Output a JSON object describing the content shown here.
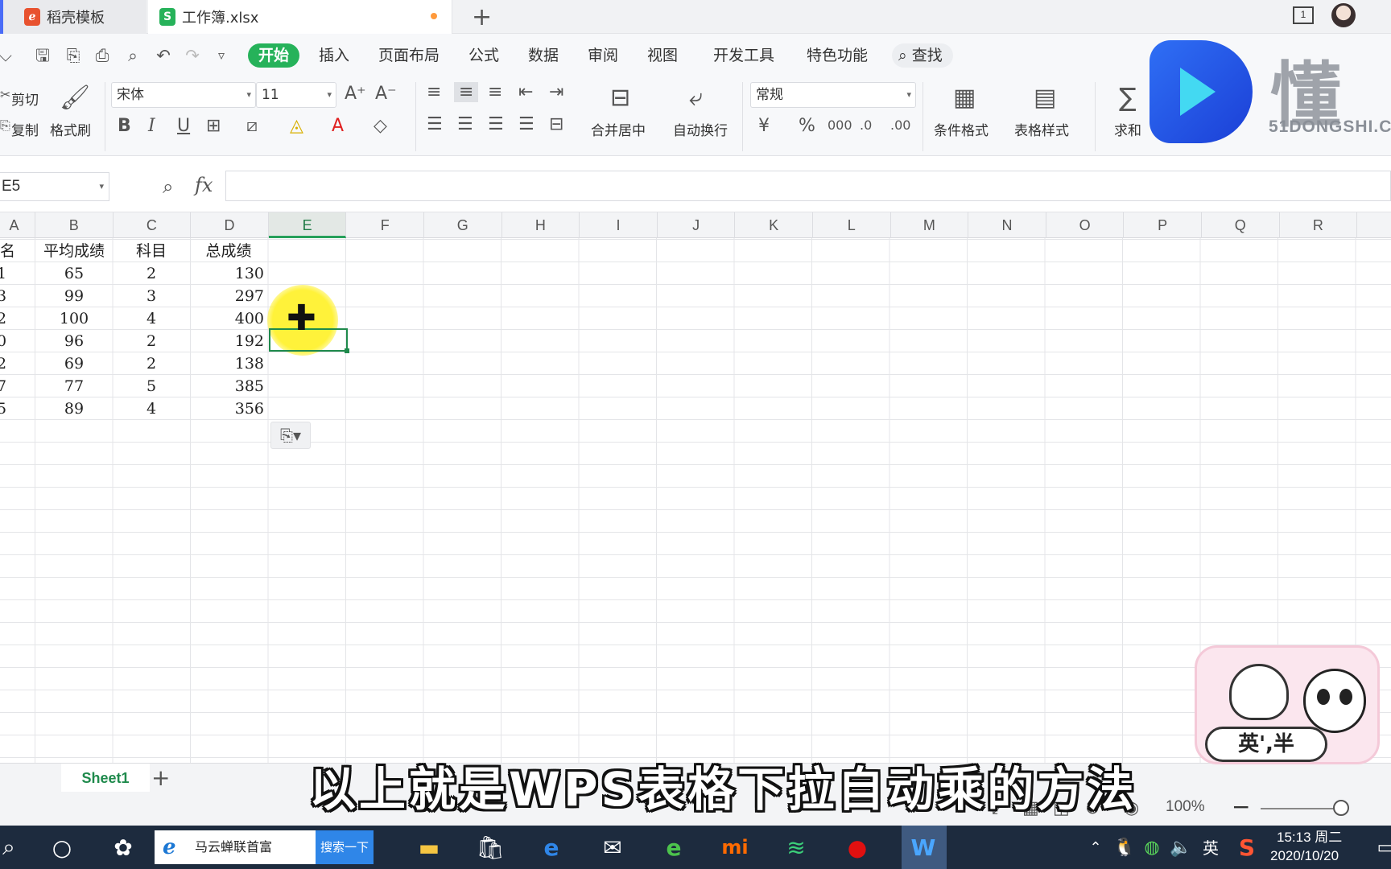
{
  "tabs": [
    {
      "label": "稻壳模板",
      "icon": "docer-icon",
      "color": "#e8522f"
    },
    {
      "label": "工作簿.xlsx",
      "icon": "spreadsheet-icon",
      "color": "#26b25a"
    }
  ],
  "menu": {
    "tabs": [
      "开始",
      "插入",
      "页面布局",
      "公式",
      "数据",
      "审阅",
      "视图",
      "开发工具",
      "特色功能"
    ],
    "search_label": "查找"
  },
  "ribbon": {
    "cut": "剪切",
    "copy": "复制",
    "format_painter": "格式刷",
    "font": "宋体",
    "font_size": "11",
    "merge_center": "合并居中",
    "wrap_text": "自动换行",
    "number_format": "常规",
    "conditional_format": "条件格式",
    "table_style": "表格样式",
    "sum": "求和"
  },
  "watermark": {
    "text": "懂事",
    "domain": "51DONGSHI.C"
  },
  "formula_bar": {
    "name_box": "E5",
    "fx_label": "fx",
    "formula": ""
  },
  "grid": {
    "columns": [
      "B",
      "C",
      "D",
      "E",
      "F",
      "G",
      "H",
      "I",
      "J",
      "K",
      "L",
      "M",
      "N",
      "O",
      "P",
      "Q",
      "R"
    ],
    "selected_column": "E",
    "headers": {
      "a": "名",
      "b": "平均成绩",
      "c": "科目",
      "d": "总成绩"
    },
    "rows": [
      {
        "a": "1",
        "b": "65",
        "c": "2",
        "d": "130"
      },
      {
        "a": "3",
        "b": "99",
        "c": "3",
        "d": "297"
      },
      {
        "a": "2",
        "b": "100",
        "c": "4",
        "d": "400"
      },
      {
        "a": "0",
        "b": "96",
        "c": "2",
        "d": "192"
      },
      {
        "a": "2",
        "b": "69",
        "c": "2",
        "d": "138"
      },
      {
        "a": "7",
        "b": "77",
        "c": "5",
        "d": "385"
      },
      {
        "a": "5",
        "b": "89",
        "c": "4",
        "d": "356"
      }
    ],
    "selected_cell": "E5"
  },
  "sheets": {
    "tabs": [
      "Sheet1"
    ],
    "add_label": "+"
  },
  "status": {
    "zoom": "100%"
  },
  "subtitle": "以上就是WPS表格下拉自动乘的方法",
  "sticker": {
    "label": "英',半"
  },
  "taskbar": {
    "search_text": "马云蝉联首富",
    "search_button": "搜索一下",
    "lang": "英",
    "time": "15:13 周二",
    "date": "2020/10/20"
  }
}
